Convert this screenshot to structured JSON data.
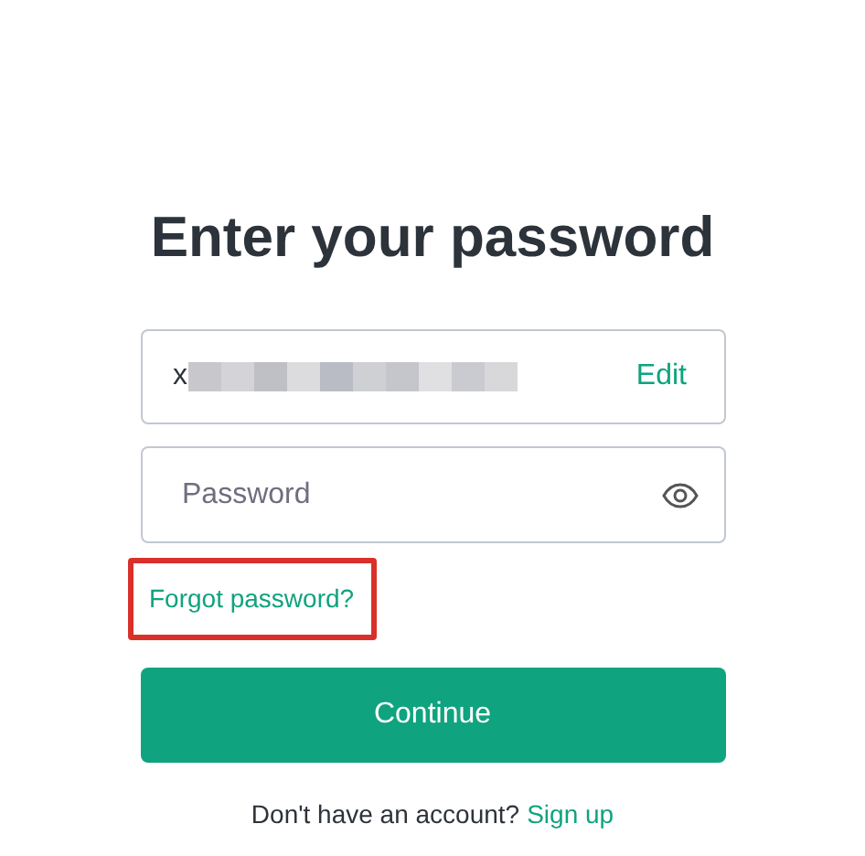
{
  "title": "Enter your password",
  "email_field": {
    "value": "x",
    "redacted": true,
    "action": "Edit"
  },
  "password_field": {
    "placeholder": "Password"
  },
  "forgot_password": {
    "label": "Forgot password?",
    "highlighted": true
  },
  "continue_button": {
    "label": "Continue"
  },
  "footer": {
    "text": "Don't have an account?",
    "link": "Sign up"
  }
}
